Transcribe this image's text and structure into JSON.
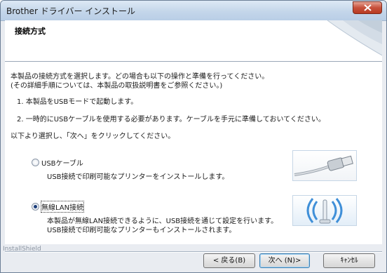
{
  "window": {
    "title": "Brother ドライバー インストール"
  },
  "header": {
    "title": "接続方式"
  },
  "intro": {
    "line1": "本製品の接続方式を選択します。どの場合も以下の操作と準備を行ってください。",
    "line2": "(その詳細手順については、本製品の取扱説明書をご参照ください。)"
  },
  "steps": [
    "1. 本製品をUSBモードで起動します。",
    "2. 一時的にUSBケーブルを使用する必要があります。ケーブルを手元に準備しておいてください。"
  ],
  "instruction": "以下より選択し、「次へ」をクリックしてください。",
  "options": [
    {
      "label": "USBケーブル",
      "description": [
        "USB接続で印刷可能なプリンターをインストールします。"
      ],
      "selected": false,
      "image": "usb-cable-image"
    },
    {
      "label": "無線LAN接続",
      "description": [
        "本製品が無線LAN接続できるように、USB接続を通じて設定を行います。",
        "USB接続で印刷可能なプリンターもインストールされます。"
      ],
      "selected": true,
      "image": "wireless-lan-image"
    }
  ],
  "footer": {
    "brand": "InstallShield",
    "back_label": "< 戻る(B)",
    "next_label": "次へ (N)>",
    "cancel_label": "ｷｬﾝｾﾙ"
  },
  "colors": {
    "accent": "#3c7fb1",
    "close": "#c7503b"
  }
}
